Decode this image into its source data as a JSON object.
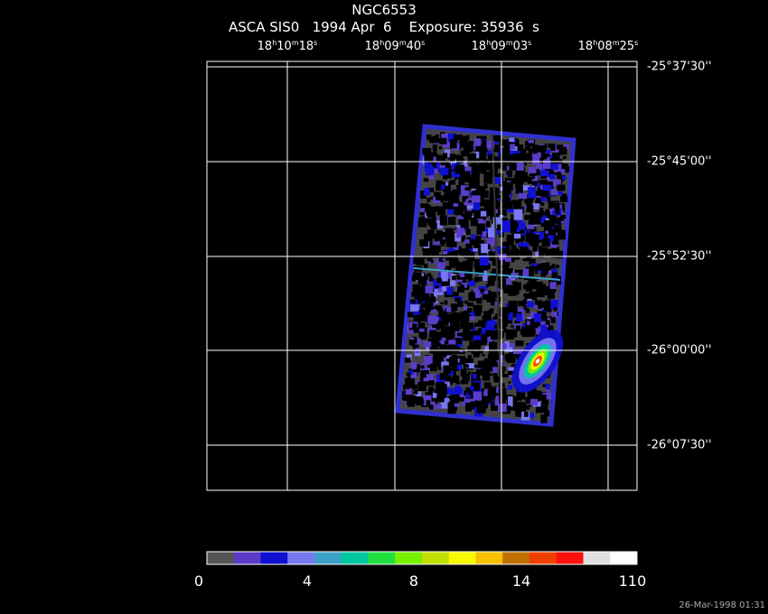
{
  "header": {
    "object": "NGC6553",
    "mission": "ASCA SIS0",
    "date": "1994 Apr  6",
    "exposure_label": "Exposure: 35936  s"
  },
  "ra_ticks": [
    {
      "h": "18",
      "m": "10",
      "s": "18"
    },
    {
      "h": "18",
      "m": "09",
      "s": "40"
    },
    {
      "h": "18",
      "m": "09",
      "s": "03"
    },
    {
      "h": "18",
      "m": "08",
      "s": "25"
    }
  ],
  "dec_ticks": [
    "-25°37'30''",
    "-25°45'00''",
    "-25°52'30''",
    "-26°00'00''",
    "-26°07'30''"
  ],
  "colorbar": {
    "colors": [
      "#555555",
      "#5a3cc8",
      "#1010d0",
      "#7878f0",
      "#3ca0c8",
      "#00c8a0",
      "#20e040",
      "#78f000",
      "#c0e000",
      "#f8f800",
      "#f8c000",
      "#c07000",
      "#f04000",
      "#ff1010",
      "#e0e0e0",
      "#ffffff"
    ],
    "labels": [
      "0",
      "4",
      "8",
      "14",
      "110"
    ]
  },
  "timestamp": "26-Mar-1998 01:31",
  "image_colors": {
    "background": "#444444",
    "edge": "#3030d0",
    "grid": "#ffffff"
  }
}
